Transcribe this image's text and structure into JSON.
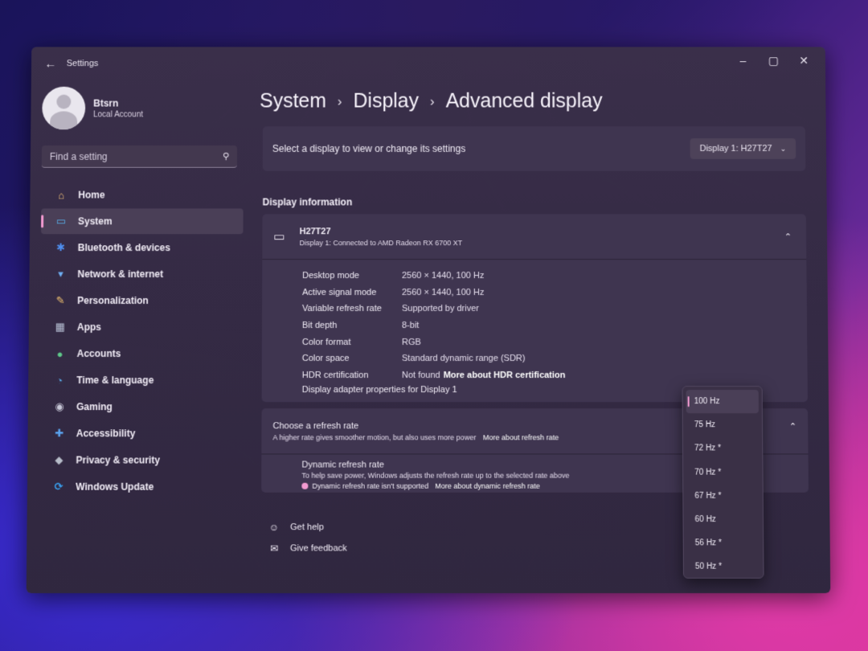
{
  "window": {
    "title": "Settings",
    "back_glyph": "←",
    "controls": {
      "minimize": "–",
      "maximize": "▢",
      "close": "✕"
    }
  },
  "profile": {
    "name": "Btsrn",
    "account_type": "Local Account"
  },
  "search": {
    "placeholder": "Find a setting"
  },
  "nav": [
    {
      "label": "Home",
      "icon": "home-icon",
      "glyph": "⌂",
      "color": "#f2c079"
    },
    {
      "label": "System",
      "icon": "monitor-icon",
      "glyph": "▭",
      "color": "#58b4f0",
      "active": true
    },
    {
      "label": "Bluetooth & devices",
      "icon": "bluetooth-icon",
      "glyph": "✱",
      "color": "#4f8ff0"
    },
    {
      "label": "Network & internet",
      "icon": "wifi-icon",
      "glyph": "▾",
      "color": "#6fb0f5"
    },
    {
      "label": "Personalization",
      "icon": "brush-icon",
      "glyph": "✎",
      "color": "#f0c070"
    },
    {
      "label": "Apps",
      "icon": "apps-icon",
      "glyph": "▦",
      "color": "#b9c2d6"
    },
    {
      "label": "Accounts",
      "icon": "person-icon",
      "glyph": "●",
      "color": "#5fc98a"
    },
    {
      "label": "Time & language",
      "icon": "globe-clock-icon",
      "glyph": "◔",
      "color": "#5aa9e6"
    },
    {
      "label": "Gaming",
      "icon": "gamepad-icon",
      "glyph": "◉",
      "color": "#c7c7d7"
    },
    {
      "label": "Accessibility",
      "icon": "accessibility-icon",
      "glyph": "✚",
      "color": "#5aa3f0"
    },
    {
      "label": "Privacy & security",
      "icon": "shield-icon",
      "glyph": "◆",
      "color": "#b7bcc9"
    },
    {
      "label": "Windows Update",
      "icon": "update-icon",
      "glyph": "⟳",
      "color": "#3aa0f0"
    }
  ],
  "breadcrumb": [
    "System",
    "Display",
    "Advanced display"
  ],
  "breadcrumb_sep": "›",
  "select_display": {
    "label": "Select a display to view or change its settings",
    "value": "Display 1: H27T27"
  },
  "display_info": {
    "section_title": "Display information",
    "monitor_name": "H27T27",
    "connection": "Display 1: Connected to AMD Radeon RX 6700 XT",
    "properties": [
      {
        "label": "Desktop mode",
        "value": "2560 × 1440, 100 Hz"
      },
      {
        "label": "Active signal mode",
        "value": "2560 × 1440, 100 Hz"
      },
      {
        "label": "Variable refresh rate",
        "value": "Supported by driver"
      },
      {
        "label": "Bit depth",
        "value": "8-bit"
      },
      {
        "label": "Color format",
        "value": "RGB"
      },
      {
        "label": "Color space",
        "value": "Standard dynamic range (SDR)"
      },
      {
        "label": "HDR certification",
        "value": "Not found",
        "link": "More about HDR certification"
      }
    ],
    "adapter_link": "Display adapter properties for Display 1"
  },
  "refresh": {
    "title": "Choose a refresh rate",
    "desc": "A higher rate gives smoother motion, but also uses more power",
    "link": "More about refresh rate",
    "dynamic_title": "Dynamic refresh rate",
    "dynamic_desc": "To help save power, Windows adjusts the refresh rate up to the selected rate above",
    "dynamic_warning": "Dynamic refresh rate isn't supported",
    "dynamic_link": "More about dynamic refresh rate"
  },
  "help": [
    {
      "label": "Get help",
      "icon": "help-icon",
      "glyph": "☺"
    },
    {
      "label": "Give feedback",
      "icon": "feedback-icon",
      "glyph": "✉"
    }
  ],
  "refresh_options": [
    {
      "label": "100 Hz",
      "selected": true
    },
    {
      "label": "75 Hz"
    },
    {
      "label": "72 Hz *"
    },
    {
      "label": "70 Hz *"
    },
    {
      "label": "67 Hz *"
    },
    {
      "label": "60 Hz"
    },
    {
      "label": "56 Hz *"
    },
    {
      "label": "50 Hz *"
    }
  ],
  "glyphs": {
    "collapse": "⌃",
    "chevron_down": "⌄",
    "search": "⚲",
    "monitor": "▭"
  }
}
